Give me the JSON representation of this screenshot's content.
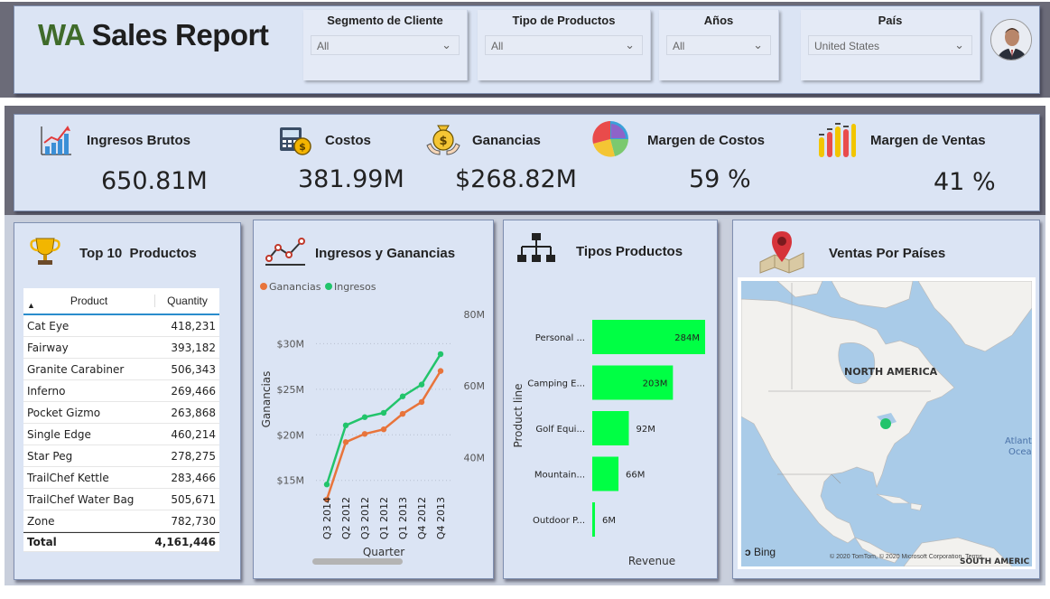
{
  "header": {
    "title_wa": "WA",
    "title_rest": " Sales Report",
    "slicers": [
      {
        "label": "Segmento de Cliente",
        "value": "All"
      },
      {
        "label": "Tipo de Productos",
        "value": "All"
      },
      {
        "label": "Años",
        "value": "All"
      },
      {
        "label": "País",
        "value": "United States"
      }
    ]
  },
  "kpis": [
    {
      "label": "Ingresos Brutos",
      "value": "650.81M",
      "icon": "growth-chart-icon"
    },
    {
      "label": "Costos",
      "value": "381.99M",
      "icon": "register-coins-icon"
    },
    {
      "label": "Ganancias",
      "value": "$268.82M",
      "icon": "money-bag-hands-icon"
    },
    {
      "label": "Margen de Costos",
      "value": "59 %",
      "icon": "pie-chart-icon"
    },
    {
      "label": "Margen de Ventas",
      "value": "41 %",
      "icon": "bar-chart-icon"
    }
  ],
  "colors": {
    "panel_bg": "#dbe4f4",
    "ganancias": "#e8743b",
    "ingresos": "#22c46b",
    "bar": "#00ff44"
  },
  "top10": {
    "title": "Top 10  Productos",
    "col_product": "Product",
    "col_quantity": "Quantity",
    "rows": [
      {
        "product": "Cat Eye",
        "quantity": "418,231"
      },
      {
        "product": "Fairway",
        "quantity": "393,182"
      },
      {
        "product": "Granite Carabiner",
        "quantity": "506,343"
      },
      {
        "product": "Inferno",
        "quantity": "269,466"
      },
      {
        "product": "Pocket Gizmo",
        "quantity": "263,868"
      },
      {
        "product": "Single Edge",
        "quantity": "460,214"
      },
      {
        "product": "Star Peg",
        "quantity": "278,275"
      },
      {
        "product": "TrailChef Kettle",
        "quantity": "283,466"
      },
      {
        "product": "TrailChef Water Bag",
        "quantity": "505,671"
      },
      {
        "product": "Zone",
        "quantity": "782,730"
      }
    ],
    "total_label": "Total",
    "total_value": "4,161,446"
  },
  "map": {
    "title": "Ventas Por Países",
    "label_na": "NORTH AMERICA",
    "label_atlantic_1": "Atlant",
    "label_atlantic_2": "Ocea",
    "label_sa": "SOUTH AMERIC",
    "bing": "Bing",
    "copyright": "© 2020 TomTom, © 2020 Microsoft Corporation, Terms"
  },
  "chart_data": [
    {
      "type": "line",
      "title": "Ingresos y Ganancias",
      "xlabel": "Quarter",
      "ylabel": "Ganancias",
      "categories": [
        "Q3 2014",
        "Q2 2012",
        "Q3 2012",
        "Q1 2012",
        "Q1 2013",
        "Q4 2012",
        "Q4 2013"
      ],
      "y_ticks_left": [
        "$15M",
        "$20M",
        "$25M",
        "$30M"
      ],
      "y_ticks_right": [
        "40M",
        "60M",
        "80M"
      ],
      "ylim_left": [
        12,
        34
      ],
      "ylim_right": [
        26,
        82
      ],
      "series": [
        {
          "name": "Ganancias",
          "axis": "left",
          "values": [
            12.9,
            19.2,
            20.1,
            20.6,
            22.3,
            23.6,
            27.0
          ]
        },
        {
          "name": "Ingresos",
          "axis": "right",
          "values": [
            32.5,
            49.0,
            51.3,
            52.5,
            57.1,
            60.4,
            68.9
          ]
        }
      ]
    },
    {
      "type": "bar",
      "orientation": "horizontal",
      "title": "Tipos Productos",
      "xlabel": "Revenue",
      "ylabel": "Product line",
      "categories": [
        "Personal ...",
        "Camping E...",
        "Golf Equi...",
        "Mountain...",
        "Outdoor P..."
      ],
      "values": [
        284,
        203,
        92,
        66,
        6
      ],
      "value_labels": [
        "284M",
        "203M",
        "92M",
        "66M",
        "6M"
      ],
      "xlim": [
        0,
        284
      ]
    }
  ]
}
